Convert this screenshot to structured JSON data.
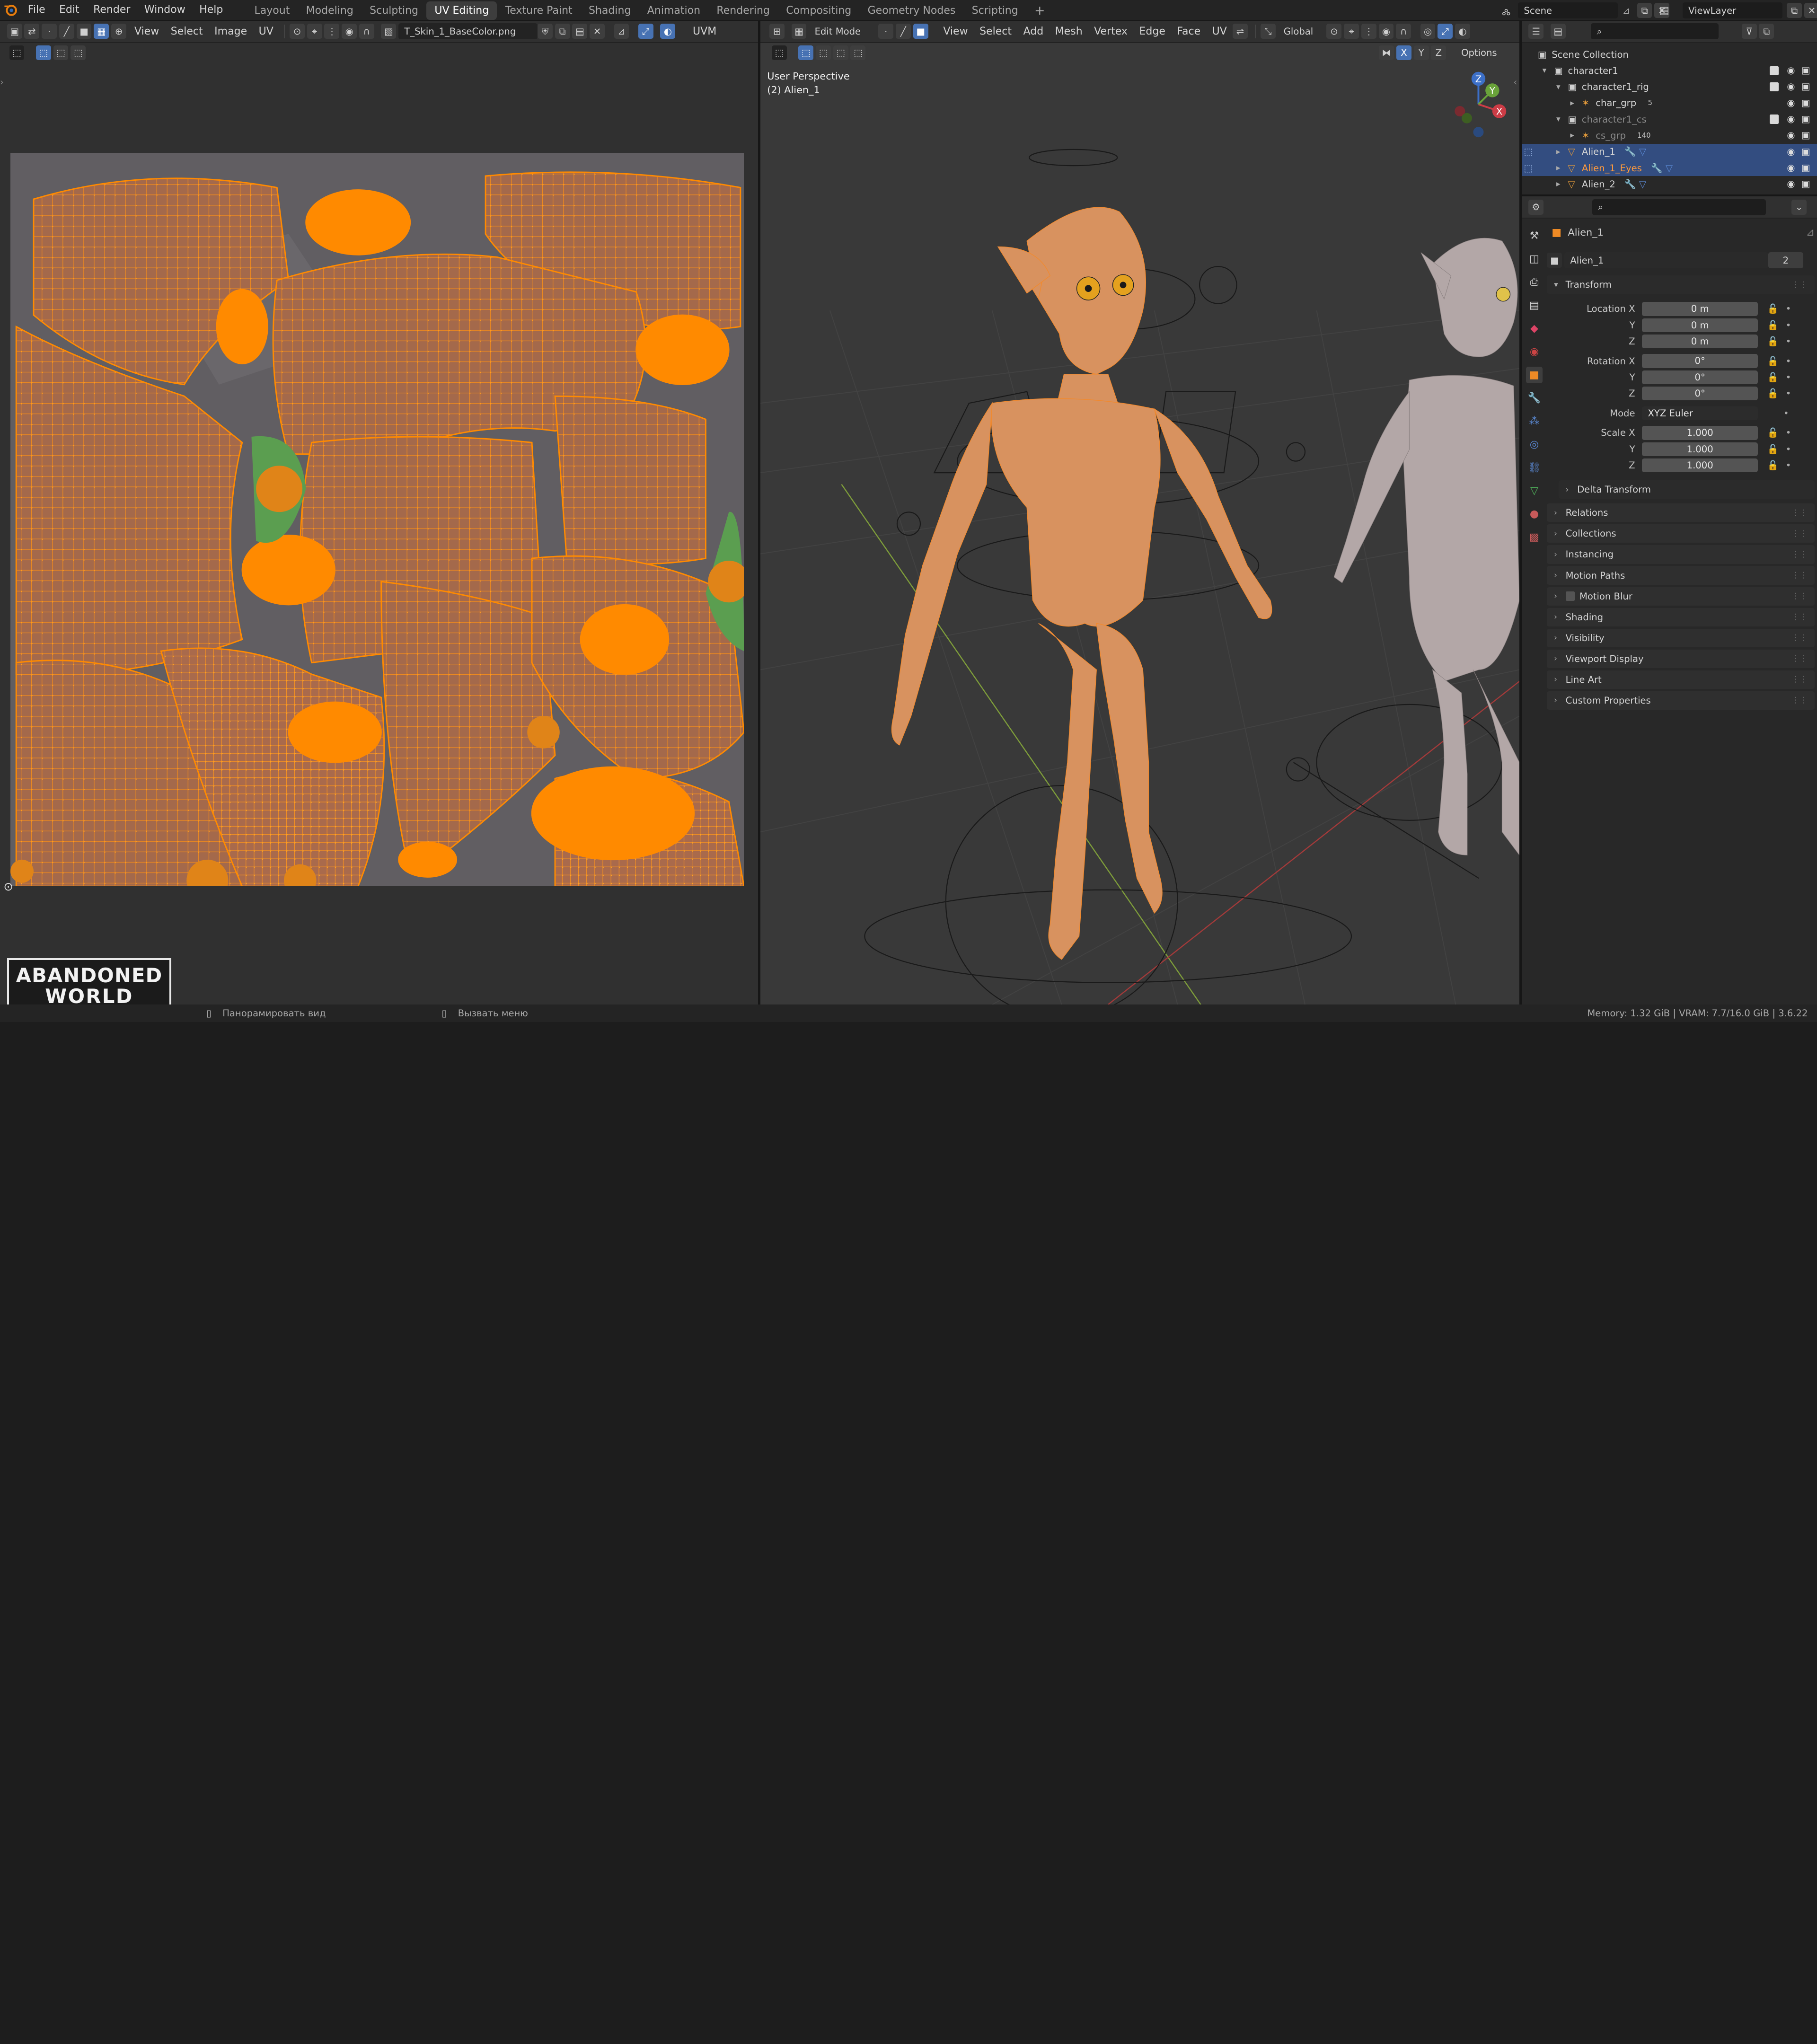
{
  "topbar": {
    "menus": [
      "File",
      "Edit",
      "Render",
      "Window",
      "Help"
    ],
    "workspaces": [
      "Layout",
      "Modeling",
      "Sculpting",
      "UV Editing",
      "Texture Paint",
      "Shading",
      "Animation",
      "Rendering",
      "Compositing",
      "Geometry Nodes",
      "Scripting"
    ],
    "active_workspace": "UV Editing",
    "add_tab": "+",
    "scene": "Scene",
    "view_layer": "ViewLayer"
  },
  "uv_editor": {
    "menus": [
      "View",
      "Select",
      "Image",
      "UV"
    ],
    "image_name": "T_Skin_1_BaseColor.png",
    "uvmap_label": "UVM"
  },
  "viewport": {
    "mode": "Edit Mode",
    "menus": [
      "View",
      "Select",
      "Add",
      "Mesh",
      "Vertex",
      "Edge",
      "Face",
      "UV"
    ],
    "orientation": "Global",
    "options": "Options",
    "xyz": [
      "X",
      "Y",
      "Z"
    ],
    "overlay_line1": "User Perspective",
    "overlay_line2": "(2) Alien_1",
    "gizmo_axes": [
      "Z",
      "Y",
      "X"
    ]
  },
  "outliner": {
    "root": "Scene Collection",
    "rows": [
      {
        "label": "character1",
        "indent": 1,
        "icon": "collection-icon",
        "sel": false,
        "dim": false,
        "badge": ""
      },
      {
        "label": "character1_rig",
        "indent": 2,
        "icon": "collection-icon",
        "sel": false,
        "dim": false,
        "badge": ""
      },
      {
        "label": "char_grp",
        "indent": 3,
        "icon": "armature-icon",
        "sel": false,
        "dim": false,
        "badge": "5"
      },
      {
        "label": "character1_cs",
        "indent": 2,
        "icon": "collection-icon",
        "sel": false,
        "dim": true,
        "badge": ""
      },
      {
        "label": "cs_grp",
        "indent": 3,
        "icon": "armature-icon",
        "sel": false,
        "dim": true,
        "badge": "140"
      },
      {
        "label": "Alien_1",
        "indent": 2,
        "icon": "mesh-icon",
        "sel": true,
        "dim": false,
        "badge": ""
      },
      {
        "label": "Alien_1_Eyes",
        "indent": 2,
        "icon": "mesh-icon",
        "sel": true,
        "dim": false,
        "badge": ""
      },
      {
        "label": "Alien_2",
        "indent": 2,
        "icon": "mesh-icon",
        "sel": false,
        "dim": false,
        "badge": ""
      }
    ]
  },
  "properties": {
    "object_name": "Alien_1",
    "data_name": "Alien_1",
    "data_users": "2",
    "transform_label": "Transform",
    "location": {
      "label": "Location X",
      "y_label": "Y",
      "z_label": "Z",
      "x": "0 m",
      "y": "0 m",
      "z": "0 m"
    },
    "rotation": {
      "label": "Rotation X",
      "y_label": "Y",
      "z_label": "Z",
      "x": "0°",
      "y": "0°",
      "z": "0°"
    },
    "mode_label": "Mode",
    "mode_value": "XYZ Euler",
    "scale": {
      "label": "Scale X",
      "y_label": "Y",
      "z_label": "Z",
      "x": "1.000",
      "y": "1.000",
      "z": "1.000"
    },
    "delta": "Delta Transform",
    "panels": [
      "Relations",
      "Collections",
      "Instancing",
      "Motion Paths",
      "Motion Blur",
      "Shading",
      "Visibility",
      "Viewport Display",
      "Line Art",
      "Custom Properties"
    ]
  },
  "statusbar": {
    "hint1": "Панорамировать вид",
    "hint2": "Вызвать меню",
    "stats": "Memory: 1.32 GiB | VRAM: 7.7/16.0 GiB | 3.6.22"
  },
  "logo": {
    "line1": "ABANDONED",
    "line2": "WORLD"
  },
  "colors": {
    "accent": "#4772b3",
    "uv_orange": "#ff8a00",
    "selection": "#334d80",
    "alien_skin": "#d8925f"
  }
}
